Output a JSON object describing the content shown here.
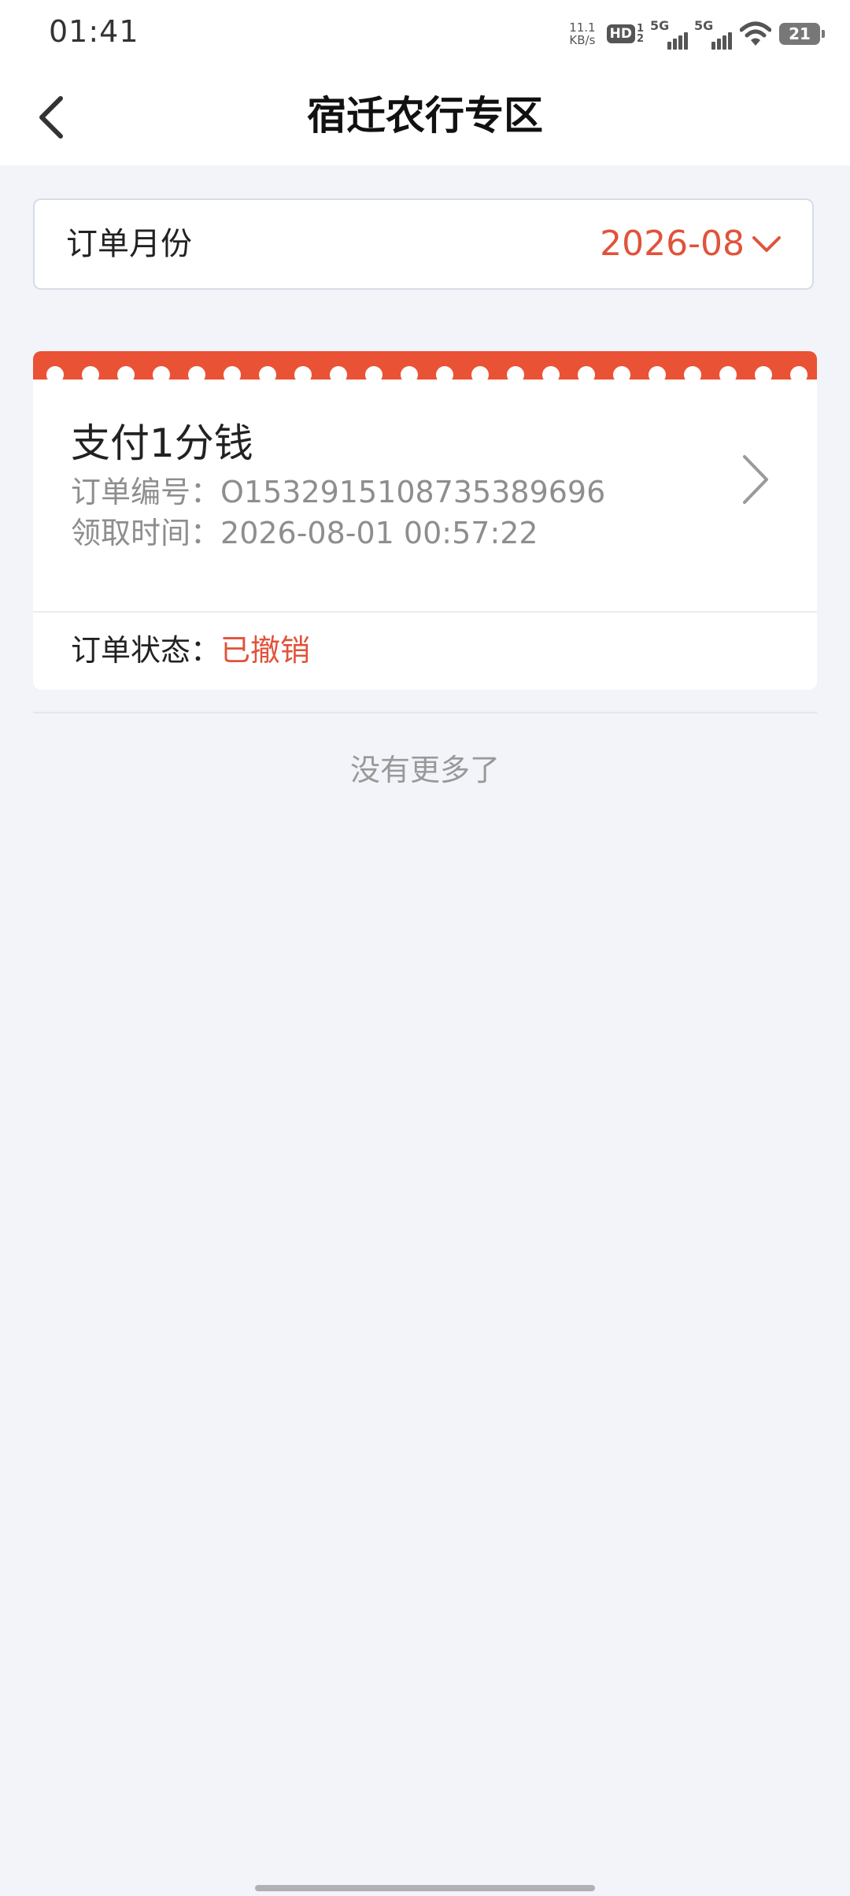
{
  "status_bar": {
    "time": "01:41",
    "net_speed_value": "11.1",
    "net_speed_unit": "KB/s",
    "hd_label": "HD",
    "hd_sub_top": "1",
    "hd_sub_bottom": "2",
    "sim1_label": "5G",
    "sim2_label": "5G",
    "battery_level": "21",
    "icons": [
      "wifi-icon",
      "battery-icon",
      "signal-icon"
    ]
  },
  "nav": {
    "title": "宿迁农行专区",
    "back_icon": "chevron-left-icon"
  },
  "filter": {
    "label": "订单月份",
    "value": "2026-08",
    "dropdown_icon": "chevron-down-icon"
  },
  "orders": [
    {
      "name": "支付1分钱",
      "order_no_label": "订单编号：",
      "order_no": "O1532915108735389696",
      "time_label": "领取时间：",
      "time": "2026-08-01 00:57:22",
      "status_label": "订单状态：",
      "status": "已撤销",
      "arrow_icon": "chevron-right-icon"
    }
  ],
  "list_footer": "没有更多了",
  "colors": {
    "accent": "#e0533b",
    "background": "#f3f4f9",
    "card": "#ffffff",
    "muted_text": "#8e8e8e"
  }
}
